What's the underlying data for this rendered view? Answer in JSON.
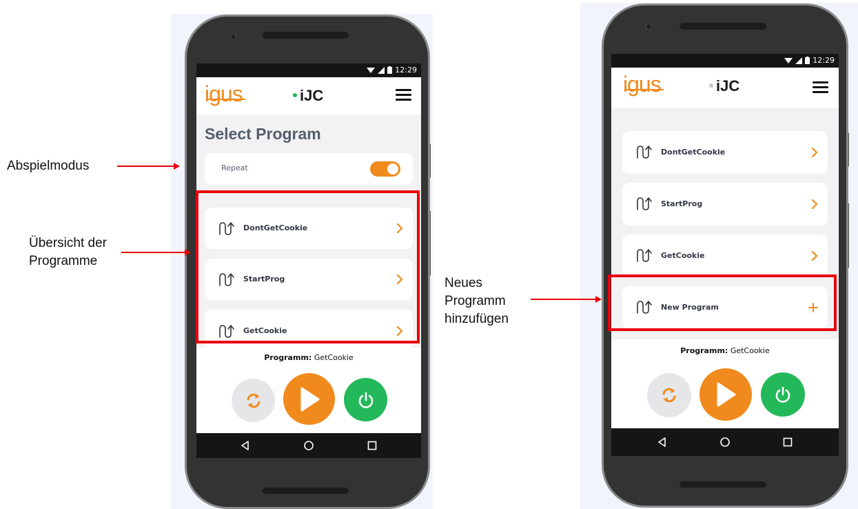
{
  "colors": {
    "accent": "#f08a1c",
    "power": "#23b85a",
    "highlight": "#e8000b",
    "title": "#555e6c"
  },
  "left_phone": {
    "status_time": "12:29",
    "header": {
      "logo_left": "igus",
      "logo_center": "iJC"
    },
    "title": "Select Program",
    "repeat": {
      "label": "Repeat",
      "on": true
    },
    "programs": [
      {
        "name": "DontGetCookie",
        "action": "chevron-right-icon"
      },
      {
        "name": "StartProg",
        "action": "chevron-right-icon"
      },
      {
        "name": "GetCookie",
        "action": "chevron-right-icon"
      }
    ],
    "current_program": {
      "label": "Programm:",
      "value": "GetCookie"
    }
  },
  "right_phone": {
    "status_time": "12:29",
    "header": {
      "logo_left": "igus",
      "logo_center": "iJC"
    },
    "programs": [
      {
        "name": "DontGetCookie",
        "action": "chevron-right-icon"
      },
      {
        "name": "StartProg",
        "action": "chevron-right-icon"
      },
      {
        "name": "GetCookie",
        "action": "chevron-right-icon"
      },
      {
        "name": "New Program",
        "action": "plus-icon"
      }
    ],
    "current_program": {
      "label": "Programm:",
      "value": "GetCookie"
    }
  },
  "annotations": {
    "playback_mode": "Abspielmodus",
    "overview_line1": "Übersicht der",
    "overview_line2": "Programme",
    "new_line1": "Neues",
    "new_line2": "Programm",
    "new_line3": "hinzufügen"
  }
}
